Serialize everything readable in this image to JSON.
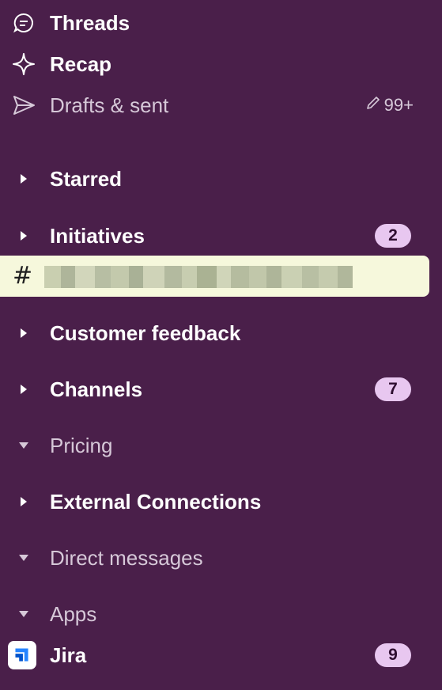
{
  "nav": {
    "threads": "Threads",
    "recap": "Recap",
    "drafts": "Drafts & sent",
    "drafts_count": "99+"
  },
  "sections": {
    "starred": "Starred",
    "initiatives": "Initiatives",
    "initiatives_badge": "2",
    "customer_feedback": "Customer feedback",
    "channels": "Channels",
    "channels_badge": "7",
    "pricing": "Pricing",
    "external_connections": "External Connections",
    "direct_messages": "Direct messages",
    "apps": "Apps"
  },
  "selected_channel": {
    "prefix": "#"
  },
  "apps": {
    "jira_label": "Jira",
    "jira_badge": "9"
  },
  "colors": {
    "background": "#4a1f4a",
    "selected_row": "#f6f8dc",
    "badge_bg": "#e8c7f0",
    "badge_text": "#2e0e30"
  }
}
